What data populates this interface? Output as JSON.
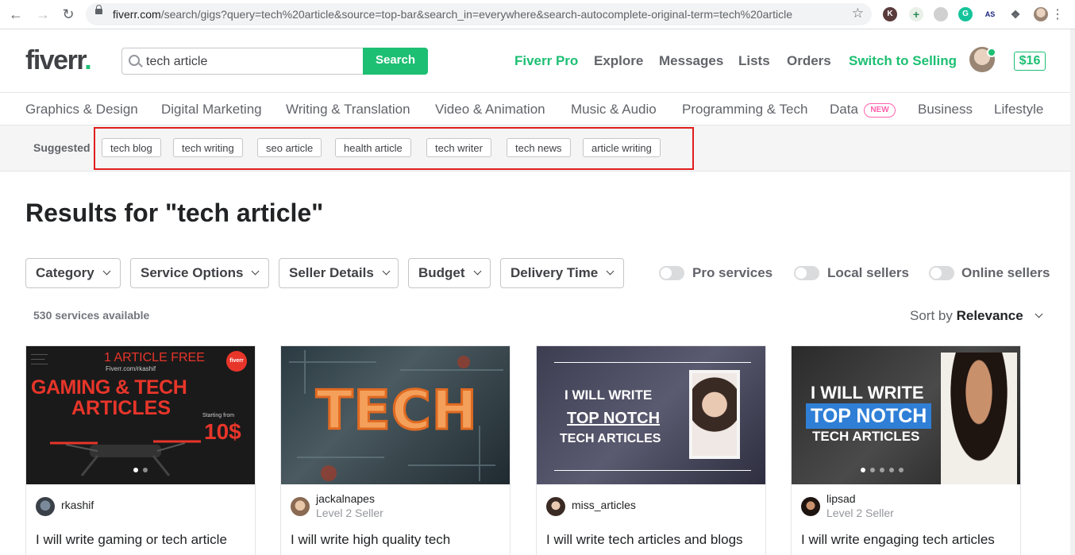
{
  "browser": {
    "url_host": "fiverr.com",
    "url_path": "/search/gigs?query=tech%20article&source=top-bar&search_in=everywhere&search-autocomplete-original-term=tech%20article"
  },
  "header": {
    "logo": "fiverr",
    "logo_dot": ".",
    "search_value": "tech article",
    "search_button": "Search",
    "nav": {
      "pro": "Fiverr Pro",
      "explore": "Explore",
      "messages": "Messages",
      "lists": "Lists",
      "orders": "Orders",
      "switch": "Switch to Selling"
    },
    "balance": "$16"
  },
  "categories": [
    "Graphics & Design",
    "Digital Marketing",
    "Writing & Translation",
    "Video & Animation",
    "Music & Audio",
    "Programming & Tech",
    "Data",
    "Business",
    "Lifestyle"
  ],
  "new_badge": "NEW",
  "suggested": {
    "label": "Suggested",
    "tags": [
      "tech blog",
      "tech writing",
      "seo article",
      "health article",
      "tech writer",
      "tech news",
      "article writing"
    ]
  },
  "results": {
    "title": "Results for \"tech article\"",
    "count": "530 services available",
    "sort_label": "Sort by",
    "sort_value": "Relevance"
  },
  "filters": [
    "Category",
    "Service Options",
    "Seller Details",
    "Budget",
    "Delivery Time"
  ],
  "toggles": [
    "Pro services",
    "Local sellers",
    "Online sellers"
  ],
  "gigs": [
    {
      "seller": "rkashif",
      "level": "",
      "title": "I will write gaming or tech article",
      "thumb_text": {
        "line1": "1 ARTICLE FREE",
        "line2": "Fiverr.com/rkashif",
        "line3": "GAMING & TECH",
        "line4": "ARTICLES",
        "line5": "Starting from",
        "line6": "10$",
        "badge": "fiverr"
      }
    },
    {
      "seller": "jackalnapes",
      "level": "Level 2 Seller",
      "title": "I will write high quality tech",
      "thumb_text": {
        "line1": "TECH"
      }
    },
    {
      "seller": "miss_articles",
      "level": "",
      "title": "I will write tech articles and blogs",
      "thumb_text": {
        "line1": "I WILL WRITE",
        "line2": "TOP NOTCH",
        "line3": "TECH ARTICLES"
      }
    },
    {
      "seller": "lipsad",
      "level": "Level 2 Seller",
      "title": "I will write engaging tech articles",
      "thumb_text": {
        "line1": "I WILL WRITE",
        "line2": "TOP NOTCH",
        "line3": "TECH ARTICLES"
      }
    }
  ],
  "colors": {
    "brand_green": "#1dbf73",
    "highlight_red": "#e01e1e",
    "new_pink": "#ff62ad"
  }
}
